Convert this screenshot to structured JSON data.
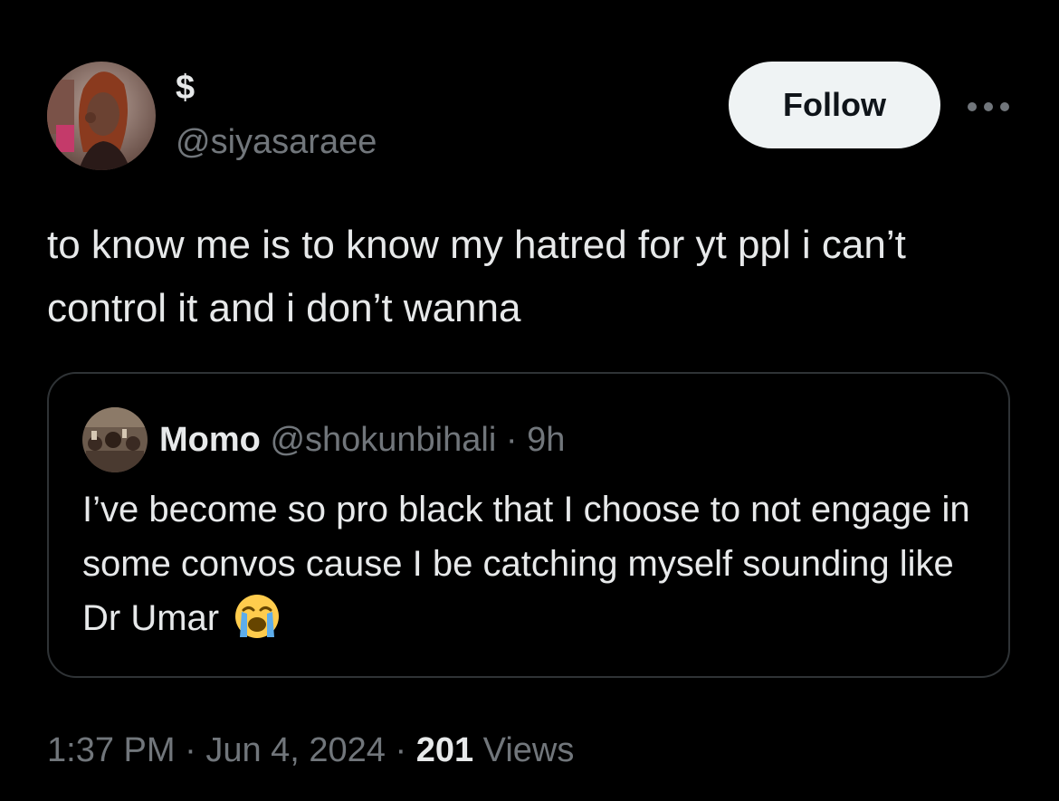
{
  "author": {
    "display_name": "$",
    "handle": "@siyasaraee",
    "avatar_icon": "profile-photo"
  },
  "follow_label": "Follow",
  "more_icon": "ellipsis-icon",
  "tweet": {
    "text": "to know me is to know my hatred for yt ppl i can’t control it and i don’t wanna"
  },
  "quote": {
    "display_name": "Momo",
    "handle": "@shokunbihali",
    "separator": "·",
    "time": "9h",
    "text": "I’ve become so pro black that I choose to not engage in some convos cause I be catching myself sounding like Dr Umar",
    "emoji_icon": "loudly-crying-face-emoji"
  },
  "footer": {
    "time": "1:37 PM",
    "separator1": "·",
    "date": "Jun 4, 2024",
    "separator2": "·",
    "views_count": "201",
    "views_label": "Views"
  },
  "colors": {
    "background": "#000000",
    "primary_text": "#e7e9ea",
    "secondary_text": "#71767b",
    "border": "#2f3336",
    "follow_bg": "#eff3f4"
  }
}
